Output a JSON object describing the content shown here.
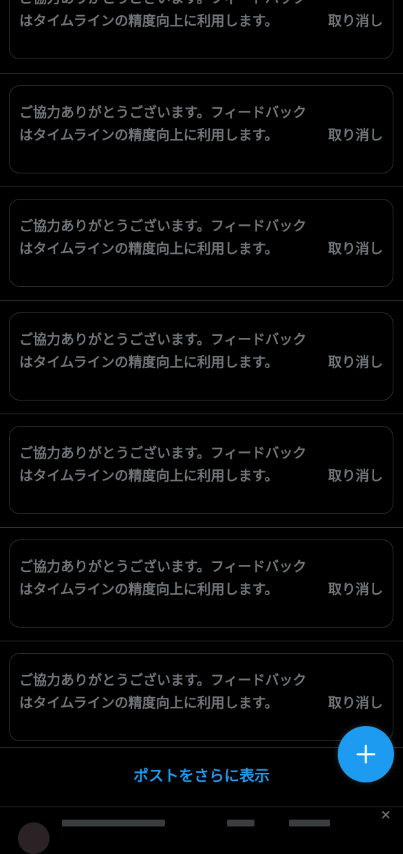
{
  "feed": {
    "feedback_cards": [
      {
        "message": "ご協力ありがとうございます。フィードバックはタイムラインの精度向上に利用します。",
        "undo_label": "取り消し"
      },
      {
        "message": "ご協力ありがとうございます。フィードバックはタイムラインの精度向上に利用します。",
        "undo_label": "取り消し"
      },
      {
        "message": "ご協力ありがとうございます。フィードバックはタイムラインの精度向上に利用します。",
        "undo_label": "取り消し"
      },
      {
        "message": "ご協力ありがとうございます。フィードバックはタイムラインの精度向上に利用します。",
        "undo_label": "取り消し"
      },
      {
        "message": "ご協力ありがとうございます。フィードバックはタイムラインの精度向上に利用します。",
        "undo_label": "取り消し"
      },
      {
        "message": "ご協力ありがとうございます。フィードバックはタイムラインの精度向上に利用します。",
        "undo_label": "取り消し"
      },
      {
        "message": "ご協力ありがとうございます。フィードバックはタイムラインの精度向上に利用します。",
        "undo_label": "取り消し"
      }
    ],
    "show_more_label": "ポストをさらに表示"
  },
  "compose_button": {
    "icon": "plus-icon"
  },
  "colors": {
    "background": "#000000",
    "border": "#2f3336",
    "muted_text": "#71767b",
    "accent": "#1d9bf0"
  }
}
